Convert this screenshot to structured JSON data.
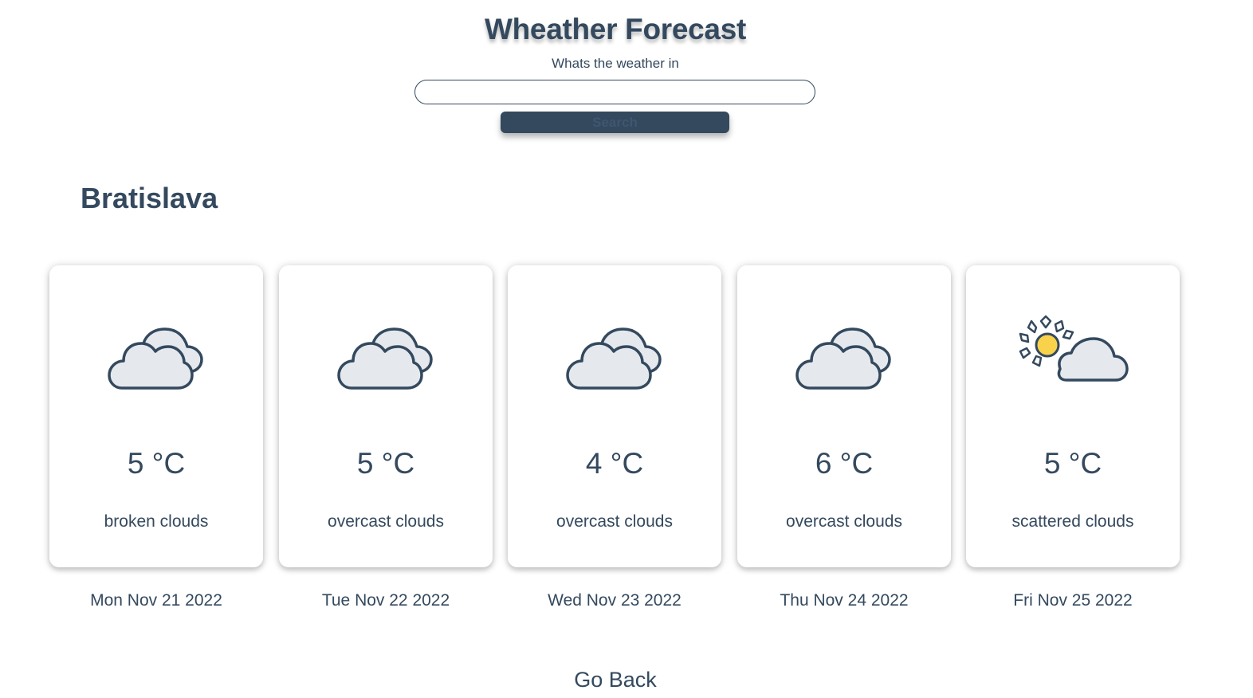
{
  "app": {
    "title": "Wheather Forecast",
    "subtitle": "Whats the weather in"
  },
  "search": {
    "value": "",
    "placeholder": "",
    "button_label": "Search"
  },
  "location": {
    "city": "Bratislava"
  },
  "forecast": [
    {
      "icon": "broken-clouds-icon",
      "temp": "5 °C",
      "description": "broken clouds",
      "date": "Mon Nov 21 2022"
    },
    {
      "icon": "overcast-clouds-icon",
      "temp": "5 °C",
      "description": "overcast clouds",
      "date": "Tue Nov 22 2022"
    },
    {
      "icon": "overcast-clouds-icon",
      "temp": "4 °C",
      "description": "overcast clouds",
      "date": "Wed Nov 23 2022"
    },
    {
      "icon": "overcast-clouds-icon",
      "temp": "6 °C",
      "description": "overcast clouds",
      "date": "Thu Nov 24 2022"
    },
    {
      "icon": "scattered-clouds-icon",
      "temp": "5 °C",
      "description": "scattered clouds",
      "date": "Fri Nov 25 2022"
    }
  ],
  "nav": {
    "go_back_label": "Go Back"
  },
  "colors": {
    "primary": "#34495e",
    "cloud_fill": "#e5e9ee",
    "sun_fill": "#f9d24c",
    "background": "#ffffff"
  }
}
